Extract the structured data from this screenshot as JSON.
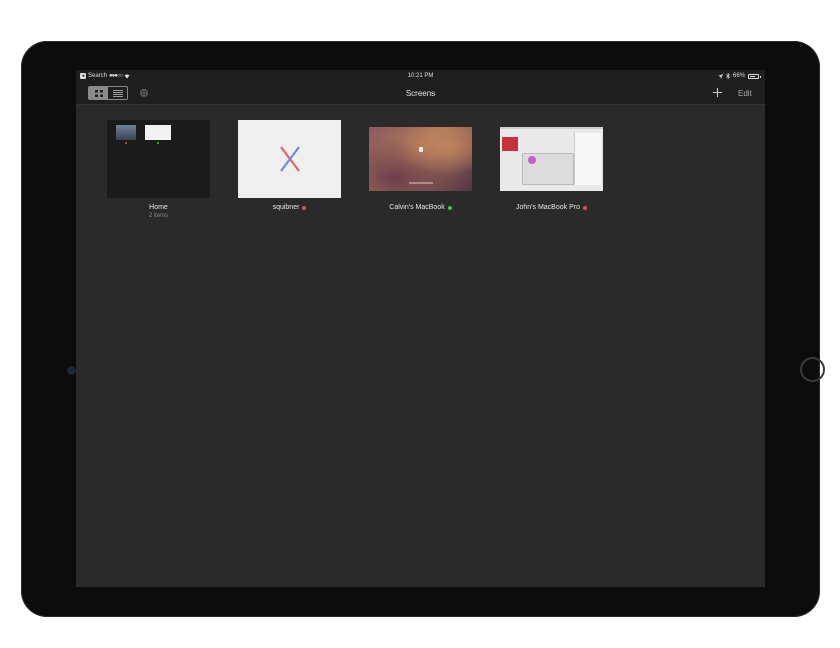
{
  "status_bar": {
    "back_label": "Search",
    "signal": "●●●○○",
    "time": "10:21 PM",
    "battery_percent": "66%",
    "battery_level": 0.66
  },
  "nav": {
    "title": "Screens",
    "edit_label": "Edit",
    "view_mode": "grid"
  },
  "icons": {
    "grid_view": "grid-icon",
    "list_view": "list-icon",
    "settings": "gear-icon",
    "add": "plus-icon",
    "wifi": "wifi-icon",
    "location": "location-arrow-icon",
    "bluetooth": "bluetooth-icon",
    "battery": "battery-icon"
  },
  "screens": [
    {
      "label": "Home",
      "sublabel": "2 items",
      "status": ""
    },
    {
      "label": "squibner",
      "status": "offline"
    },
    {
      "label": "Calvin's MacBook",
      "status": "online"
    },
    {
      "label": "John's MacBook Pro",
      "status": "offline"
    }
  ],
  "colors": {
    "online": "#3ec43e",
    "offline": "#e05050",
    "background": "#2a2a2a",
    "bar": "#1f1f1f"
  }
}
